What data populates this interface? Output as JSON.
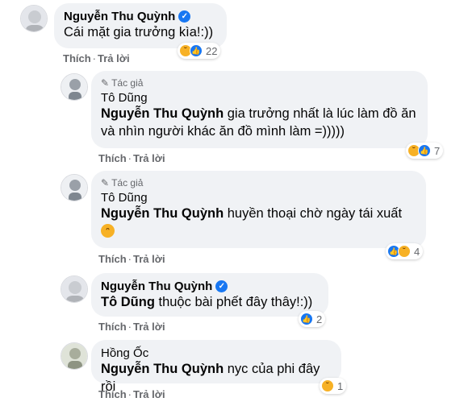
{
  "comments": [
    {
      "author": "Nguyễn Thu Quỳnh",
      "verified": true,
      "text": "Cái mặt gia trưởng kìa!:))",
      "actions": {
        "like": "Thích",
        "reply": "Trả lời"
      },
      "reactions": {
        "types": [
          "haha",
          "like"
        ],
        "count": "22"
      }
    },
    {
      "badge": "Tác giả",
      "author": "Tô Dũng",
      "mention": "Nguyễn Thu Quỳnh",
      "text": " gia trưởng nhất là lúc làm đồ ăn và nhìn người khác ăn đồ mình làm =)))))",
      "actions": {
        "like": "Thích",
        "reply": "Trả lời"
      },
      "reactions": {
        "types": [
          "haha",
          "like"
        ],
        "count": "7"
      }
    },
    {
      "badge": "Tác giả",
      "author": "Tô Dũng",
      "mention": "Nguyễn Thu Quỳnh",
      "text": " huyền thoại chờ ngày tái xuất",
      "emoji": "rofl",
      "actions": {
        "like": "Thích",
        "reply": "Trả lời"
      },
      "reactions": {
        "types": [
          "like",
          "haha"
        ],
        "count": "4"
      }
    },
    {
      "author": "Nguyễn Thu Quỳnh",
      "verified": true,
      "mention": "Tô Dũng",
      "text": " thuộc bài phết đây thây!:))",
      "actions": {
        "like": "Thích",
        "reply": "Trả lời"
      },
      "reactions": {
        "types": [
          "like"
        ],
        "count": "2"
      }
    },
    {
      "author": "Hồng Ốc",
      "mention": "Nguyễn Thu Quỳnh",
      "text": " nyc của phi đây rồi",
      "actions": {
        "like": "Thích",
        "reply": "Trả lời"
      },
      "reactions": {
        "types": [
          "haha"
        ],
        "count": "1"
      }
    }
  ],
  "colors": {
    "bubble": "#f0f2f5",
    "meta": "#65676b",
    "like_blue": "#1877f2",
    "haha_yellow": "#f7b125"
  }
}
